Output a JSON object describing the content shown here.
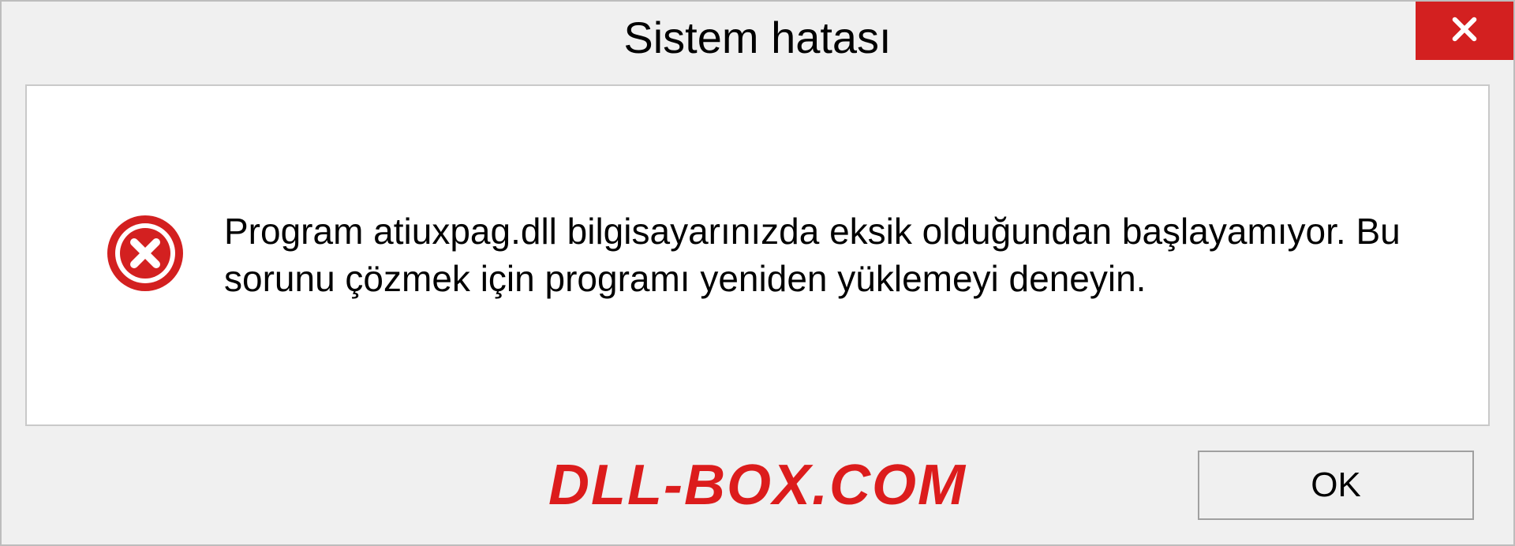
{
  "dialog": {
    "title": "Sistem hatası",
    "message": "Program atiuxpag.dll bilgisayarınızda eksik olduğundan başlayamıyor. Bu sorunu çözmek için programı yeniden yüklemeyi deneyin.",
    "ok_label": "OK"
  },
  "watermark": "DLL-BOX.COM",
  "colors": {
    "close_bg": "#d32020",
    "error_icon": "#d32020",
    "watermark": "#dc1c1c"
  }
}
